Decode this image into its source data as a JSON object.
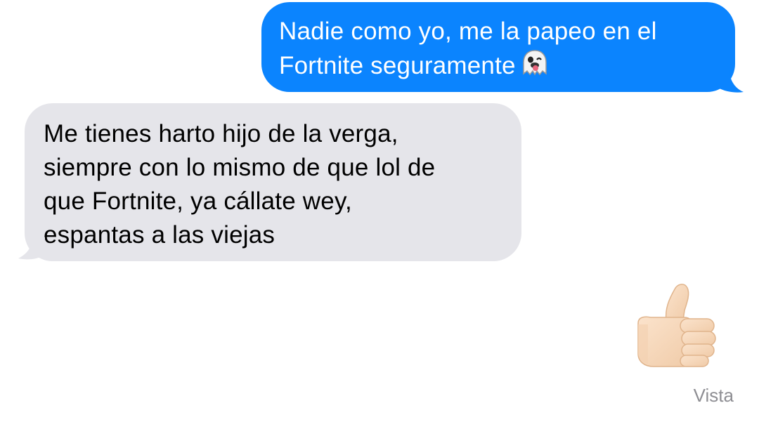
{
  "messages": [
    {
      "direction": "outgoing",
      "lines": [
        "Nadie como yo, me la papeo en el",
        "Fortnite seguramente"
      ],
      "trailing_emoji": "ghost-emoji",
      "bubble_color": "#0b84fe",
      "text_color": "#ffffff"
    },
    {
      "direction": "incoming",
      "lines": [
        "Me tienes harto hijo de la verga,",
        "siempre con lo mismo de que lol de",
        "que Fortnite, ya cállate wey,",
        "espantas a las viejas"
      ],
      "bubble_color": "#e5e5ea",
      "text_color": "#000000"
    },
    {
      "direction": "outgoing",
      "emoji": "thumbs-up-emoji"
    }
  ],
  "status": {
    "label": "Vista",
    "color": "#8e8e93"
  }
}
